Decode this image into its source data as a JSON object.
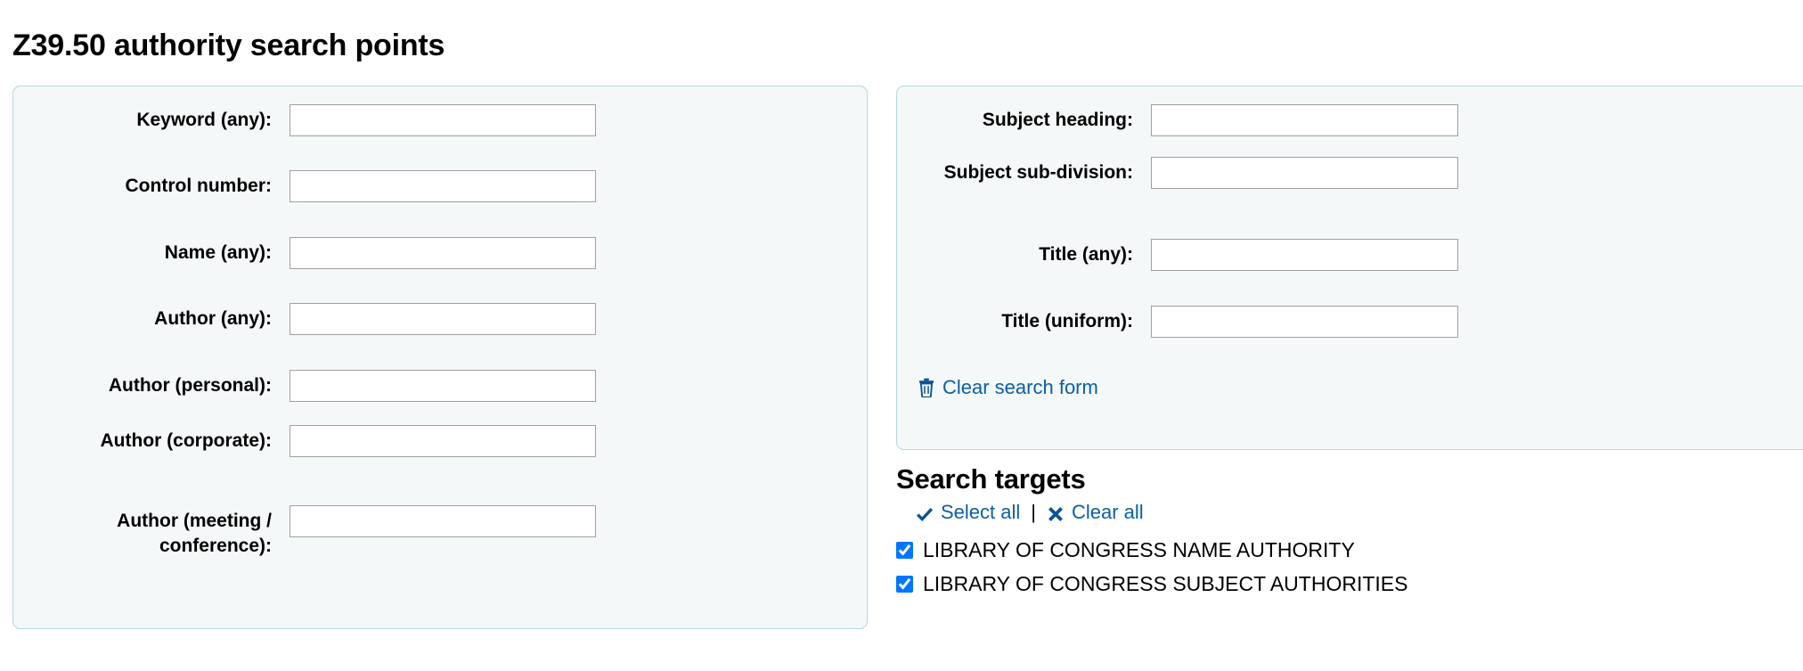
{
  "page": {
    "title": "Z39.50 authority search points"
  },
  "colors": {
    "link": "#0a5ea8",
    "icon_blue": "#0b5394",
    "panel_bg": "#f4f8f9",
    "panel_border": "#b6d6da",
    "input_border": "#a0a0a0",
    "text": "#000000"
  },
  "left_panel": {
    "fields": [
      {
        "label": "Keyword (any):",
        "value": "",
        "placeholder": "",
        "name": "keyword-any"
      },
      {
        "label": "Control number:",
        "value": "",
        "placeholder": "",
        "name": "control-number"
      },
      {
        "label": "Name (any):",
        "value": "",
        "placeholder": "",
        "name": "name-any"
      },
      {
        "label": "Author (any):",
        "value": "",
        "placeholder": "",
        "name": "author-any"
      },
      {
        "label": "Author (personal):",
        "value": "",
        "placeholder": "",
        "name": "author-personal"
      },
      {
        "label": "Author (corporate):",
        "value": "",
        "placeholder": "",
        "name": "author-corporate"
      },
      {
        "label": "Author (meeting / conference):",
        "value": "",
        "placeholder": "",
        "name": "author-meeting-conference"
      }
    ]
  },
  "right_panel": {
    "fields": [
      {
        "label": "Subject heading:",
        "value": "",
        "placeholder": "",
        "name": "subject-heading"
      },
      {
        "label": "Subject sub-division:",
        "value": "",
        "placeholder": "",
        "name": "subject-subdivision"
      },
      {
        "label": "Title (any):",
        "value": "",
        "placeholder": "",
        "name": "title-any"
      },
      {
        "label": "Title (uniform):",
        "value": "",
        "placeholder": "",
        "name": "title-uniform"
      }
    ],
    "clear_form_label": "Clear search form",
    "clear_form_icon": "trash-icon"
  },
  "search_targets": {
    "heading": "Search targets",
    "select_all_label": "Select all",
    "select_all_icon": "check-icon",
    "separator": "|",
    "clear_all_label": "Clear all",
    "clear_all_icon": "cross-icon",
    "items": [
      {
        "label": "LIBRARY OF CONGRESS NAME AUTHORITY",
        "checked": true
      },
      {
        "label": "LIBRARY OF CONGRESS SUBJECT AUTHORITIES",
        "checked": true
      }
    ]
  }
}
